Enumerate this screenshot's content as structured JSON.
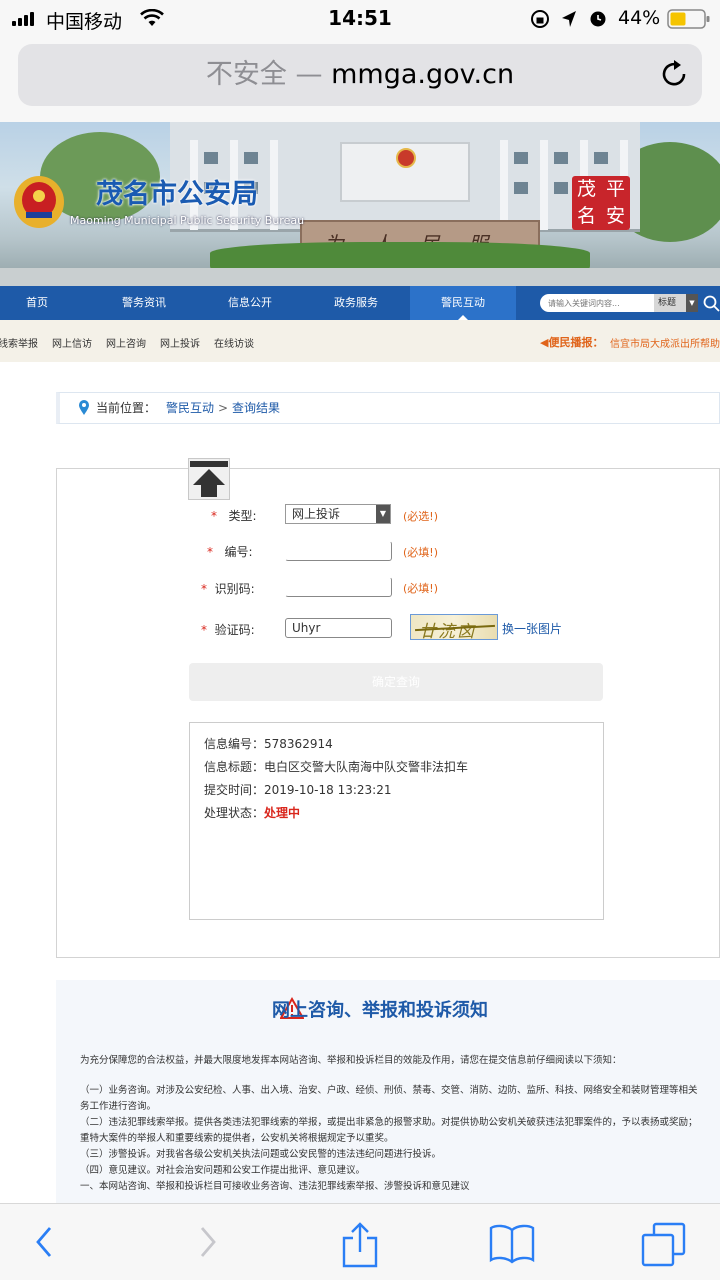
{
  "status_bar": {
    "carrier": "中国移动",
    "time": "14:51",
    "battery_percent": "44%"
  },
  "url_bar": {
    "insecure_label": "不安全 —",
    "domain": "mmga.gov.cn"
  },
  "banner": {
    "site_title": "茂名市公安局",
    "site_subtitle": "Maoming Municipal Public Security Bureau",
    "wall_text": "为人民服务",
    "badge_chars": [
      "茂",
      "平",
      "名",
      "安"
    ]
  },
  "nav": {
    "items": [
      {
        "label": "首页"
      },
      {
        "label": "警务资讯"
      },
      {
        "label": "信息公开"
      },
      {
        "label": "政务服务"
      },
      {
        "label": "警民互动"
      }
    ],
    "search_placeholder": "请输入关键词内容...",
    "search_scope": "标题"
  },
  "subnav": {
    "items": [
      {
        "label": "线索举报"
      },
      {
        "label": "网上信访"
      },
      {
        "label": "网上咨询"
      },
      {
        "label": "网上投诉"
      },
      {
        "label": "在线访谈"
      }
    ],
    "notice_label": "◀便民播报：",
    "notice_text": "信宜市局大成派出所帮助"
  },
  "breadcrumb": {
    "label": "当前位置：",
    "level1": "警民互动",
    "separator": ">",
    "level2": "查询结果"
  },
  "form": {
    "type_label": "类型:",
    "type_value": "网上投诉",
    "type_hint": "(必选!)",
    "id_label": "编号:",
    "id_hint": "(必填!)",
    "code_label": "识别码:",
    "code_hint": "(必填!)",
    "captcha_label": "验证码:",
    "captcha_value": "Uhyr",
    "captcha_image_text": "廿㳘㐫",
    "refresh_link": "换一张图片",
    "submit_label": "确定查询",
    "required_mark": "*"
  },
  "result": {
    "info_no_label": "信息编号：",
    "info_no": "578362914",
    "title_label": "信息标题：",
    "title": "电白区交警大队南海中队交警非法扣车",
    "time_label": "提交时间：",
    "time": "2019-10-18 13:23:21",
    "status_label": "处理状态：",
    "status": "处理中"
  },
  "notice": {
    "title": "网上咨询、举报和投诉须知",
    "intro": "为充分保障您的合法权益，并最大限度地发挥本网站咨询、举报和投诉栏目的效能及作用，请您在提交信息前仔细阅读以下须知：",
    "items": [
      "（一）业务咨询。对涉及公安纪检、人事、出入境、治安、户政、经侦、刑侦、禁毒、交管、消防、边防、监所、科技、网络安全和装财管理等相关",
      "务工作进行咨询。",
      "（二）违法犯罪线索举报。提供各类违法犯罪线索的举报，或提出非紧急的报警求助。对提供协助公安机关破获违法犯罪案件的，予以表扬或奖励；",
      "重特大案件的举报人和重要线索的提供者，公安机关将根据规定予以重奖。",
      "（三）涉警投诉。对我省各级公安机关执法问题或公安民警的违法违纪问题进行投诉。",
      "（四）意见建议。对社会治安问题和公安工作提出批评、意见建议。",
      "一、本网站咨询、举报和投诉栏目可接收业务咨询、违法犯罪线索举报、涉警投诉和意见建议"
    ]
  },
  "colors": {
    "brand_blue": "#1e5aa8",
    "warn_red": "#d9261c",
    "hint_orange": "#e0641a"
  }
}
